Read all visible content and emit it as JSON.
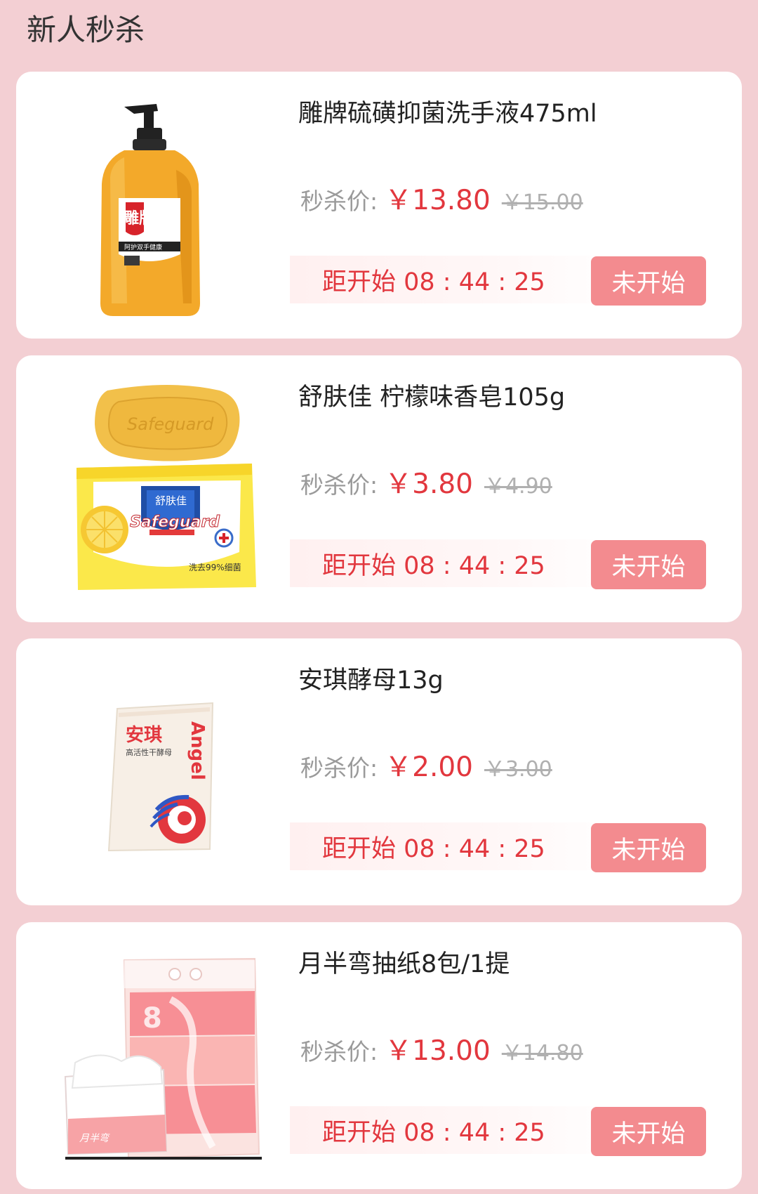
{
  "page": {
    "title": "新人秒杀"
  },
  "products": [
    {
      "name": "雕牌硫磺抑菌洗手液475ml",
      "price_label": "秒杀价:",
      "price": "￥13.80",
      "original_price": "￥15.00",
      "countdown": "距开始 08 : 44 : 25",
      "button_label": "未开始",
      "image_icon": "hand-soap-bottle",
      "image_text": {
        "brand": "雕牌",
        "sub": "阿护双手健康"
      }
    },
    {
      "name": "舒肤佳 柠檬味香皂105g",
      "price_label": "秒杀价:",
      "price": "￥3.80",
      "original_price": "￥4.90",
      "countdown": "距开始 08 : 44 : 25",
      "button_label": "未开始",
      "image_icon": "soap-bar-box",
      "image_text": {
        "bar": "Safeguard",
        "brand_cn": "舒肤佳",
        "brand_en": "Safeguard",
        "claim": "洗去99%细菌"
      }
    },
    {
      "name": "安琪酵母13g",
      "price_label": "秒杀价:",
      "price": "￥2.00",
      "original_price": "￥3.00",
      "countdown": "距开始 08 : 44 : 25",
      "button_label": "未开始",
      "image_icon": "yeast-packet",
      "image_text": {
        "brand_cn": "安琪",
        "brand_en": "Angel",
        "sub": "高活性干酵母"
      }
    },
    {
      "name": "月半弯抽纸8包/1提",
      "price_label": "秒杀价:",
      "price": "￥13.00",
      "original_price": "￥14.80",
      "countdown": "距开始 08 : 44 : 25",
      "button_label": "未开始",
      "image_icon": "tissue-pack",
      "image_text": {
        "brand": "月半弯",
        "count": "8"
      }
    }
  ],
  "colors": {
    "background": "#f3cfd3",
    "accent_red": "#e2373e",
    "button_pink": "#f38b8f"
  }
}
